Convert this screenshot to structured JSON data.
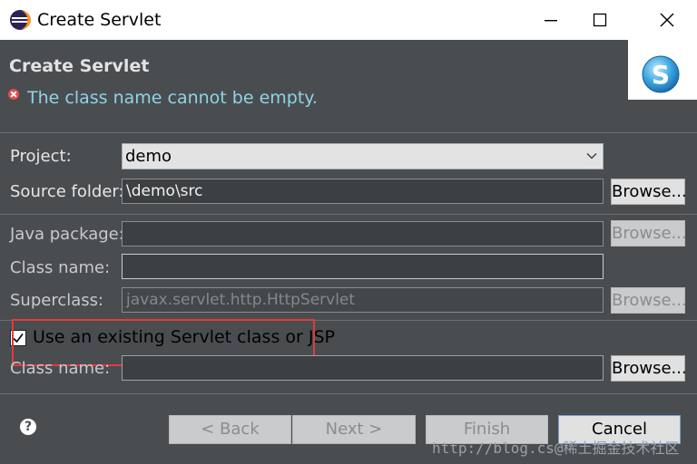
{
  "window": {
    "title": "Create Servlet"
  },
  "header": {
    "title": "Create Servlet",
    "error_message": "The class name cannot be empty."
  },
  "form": {
    "project_label": "Project:",
    "project_value": "demo",
    "source_folder_label": "Source folder:",
    "source_folder_value": "\\demo\\src",
    "java_package_label": "Java package:",
    "java_package_value": "",
    "class_name_label": "Class name:",
    "class_name_value": "",
    "superclass_label": "Superclass:",
    "superclass_value": "javax.servlet.http.HttpServlet",
    "use_existing_label": "Use an existing Servlet class or JSP",
    "use_existing_checked": true,
    "existing_class_label": "Class name:",
    "existing_class_value": "",
    "browse_label": "Browse..."
  },
  "buttons": {
    "back": "< Back",
    "next": "Next >",
    "finish": "Finish",
    "cancel": "Cancel"
  },
  "watermark": "http://blog.cs@稀土掘金技术社区",
  "colors": {
    "dialog_bg": "#4a4d50",
    "error_text": "#8fd3e8",
    "highlight_box": "#e03b3b"
  }
}
